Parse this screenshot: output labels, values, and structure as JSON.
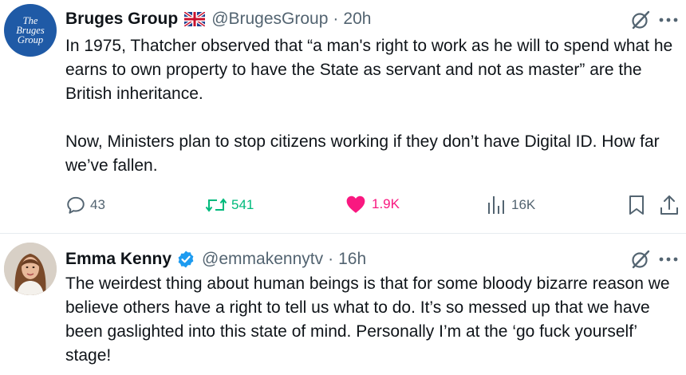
{
  "tweet1": {
    "avatar_lines": [
      "The",
      "Bruges",
      "Group"
    ],
    "name": "Bruges Group",
    "flag_emoji": "uk-flag-icon",
    "handle": "@BrugesGroup",
    "separator": "·",
    "time": "20h",
    "body": "In 1975, Thatcher observed that “a man's right to work as he will to spend what he earns to own property to have the State as servant and not as master” are the British inheritance.\n\nNow, Ministers plan to stop citizens working if they don’t have Digital ID. How far we’ve fallen.",
    "replies": "43",
    "reposts": "541",
    "likes": "1.9K",
    "views": "16K"
  },
  "tweet2": {
    "name": "Emma Kenny",
    "handle": "@emmakennytv",
    "separator": "·",
    "time": "16h",
    "body": "The weirdest thing about human beings is that for some bloody bizarre reason we believe others have a right to tell us what to do. It’s so messed up that we have been gaslighted into this state of mind. Personally I’m at the ‘go fuck yourself’ stage!"
  },
  "colors": {
    "text": "#0f1419",
    "secondary": "#536471",
    "repost_green": "#00ba7c",
    "like_pink": "#f91880",
    "verified_blue": "#1d9bf0",
    "bruges_blue": "#1f5aa6"
  }
}
